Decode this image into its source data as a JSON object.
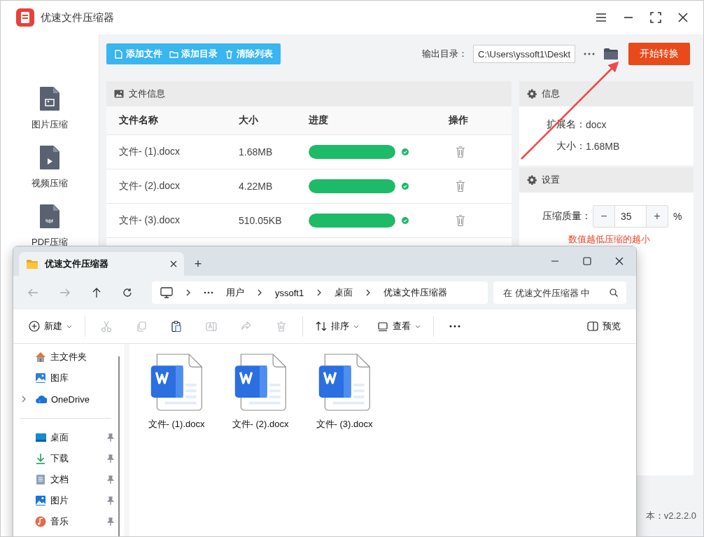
{
  "app": {
    "title": "优速文件压缩器"
  },
  "sidebar": {
    "items": [
      {
        "label": "图片压缩",
        "kind": "image"
      },
      {
        "label": "视频压缩",
        "kind": "video"
      },
      {
        "label": "PDF压缩",
        "kind": "pdf"
      }
    ]
  },
  "toolbar": {
    "buttons": [
      {
        "label": "添加文件",
        "kind": "file"
      },
      {
        "label": "添加目录",
        "kind": "folder"
      },
      {
        "label": "清除列表",
        "kind": "trash"
      }
    ],
    "output_label": "输出目录：",
    "output_path": "C:\\Users\\yssoft1\\Deskt",
    "start_button": "开始转换"
  },
  "file_panel": {
    "title": "文件信息",
    "columns": [
      "文件名称",
      "大小",
      "进度",
      "操作"
    ],
    "rows": [
      {
        "name": "文件- (1).docx",
        "size": "1.68MB",
        "level": 1,
        "done": true
      },
      {
        "name": "文件- (2).docx",
        "size": "4.22MB",
        "level": 1,
        "done": true
      },
      {
        "name": "文件- (3).docx",
        "size": "510.05KB",
        "level": 1,
        "done": true
      }
    ]
  },
  "info_panel": {
    "title": "信息",
    "fields": [
      {
        "label": "扩展名：",
        "value": "docx"
      },
      {
        "label": "大小：",
        "value": "1.68MB"
      }
    ]
  },
  "settings_panel": {
    "title": "设置",
    "quality_label": "压缩质量：",
    "minus": "−",
    "quality_value": "35",
    "plus": "+",
    "unit": "%",
    "hint": "数值越低压缩的越小"
  },
  "version": "本：v2.2.2.0",
  "explorer": {
    "tab": {
      "title": "优速文件压缩器",
      "plus": "+"
    },
    "breadcrumb": [
      "用户",
      "yssoft1",
      "桌面",
      "优速文件压缩器"
    ],
    "search": {
      "placeholder": "在 优速文件压缩器 中"
    },
    "commands": [
      {
        "kind": "new",
        "label": "新建",
        "disabled": false
      },
      {
        "kind": "cut",
        "disabled": true
      },
      {
        "kind": "copy",
        "disabled": true
      },
      {
        "kind": "paste",
        "disabled": false
      },
      {
        "kind": "rename",
        "disabled": true
      },
      {
        "kind": "share",
        "disabled": true
      },
      {
        "kind": "delete",
        "disabled": true
      },
      {
        "kind": "sort",
        "label": "排序",
        "disabled": false
      },
      {
        "kind": "view",
        "label": "查看",
        "disabled": false
      },
      {
        "kind": "more",
        "disabled": false
      }
    ],
    "preview": "预览",
    "nav": [
      {
        "label": "主文件夹",
        "kind": "home",
        "expandable": false
      },
      {
        "label": "图库",
        "kind": "gallery",
        "expandable": false
      },
      {
        "label": "OneDrive",
        "kind": "cloud",
        "expandable": true
      }
    ],
    "quick_access": [
      {
        "label": "桌面",
        "kind": "desktop",
        "pinned": true
      },
      {
        "label": "下载",
        "kind": "download",
        "pinned": true
      },
      {
        "label": "文档",
        "kind": "document",
        "pinned": true
      },
      {
        "label": "图片",
        "kind": "pictures",
        "pinned": true
      },
      {
        "label": "音乐",
        "kind": "music",
        "pinned": true
      }
    ],
    "files": [
      {
        "name": "文件- (1).docx"
      },
      {
        "name": "文件- (2).docx"
      },
      {
        "name": "文件- (3).docx"
      }
    ]
  }
}
